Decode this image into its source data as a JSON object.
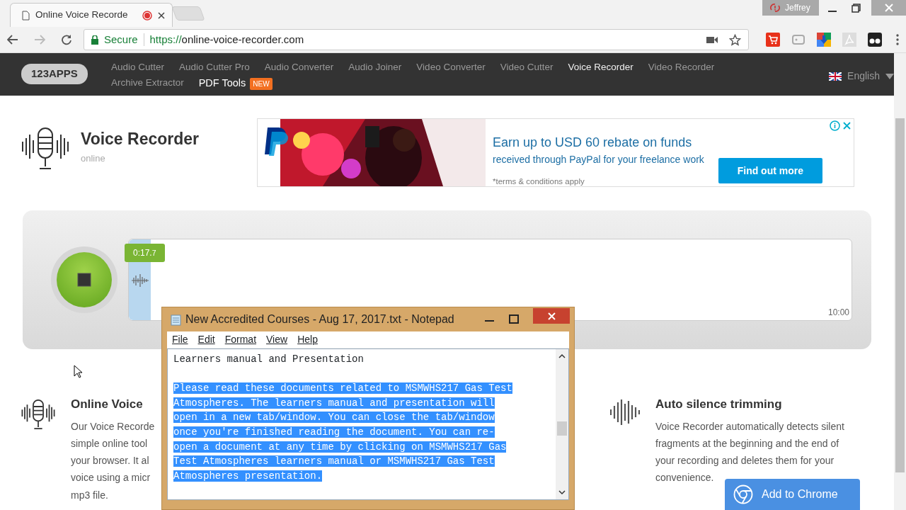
{
  "browser": {
    "tab": {
      "title": "Online Voice Recorde",
      "recording": true
    },
    "user": "Jeffrey",
    "address": {
      "security": "Secure",
      "url_scheme": "https://",
      "url_host": "online-voice-recorder.com"
    }
  },
  "site_nav": {
    "logo": "123APPS",
    "items": [
      {
        "label": "Audio Cutter",
        "selected": false
      },
      {
        "label": "Audio Cutter Pro",
        "selected": false
      },
      {
        "label": "Audio Converter",
        "selected": false
      },
      {
        "label": "Audio Joiner",
        "selected": false
      },
      {
        "label": "Video Converter",
        "selected": false
      },
      {
        "label": "Video Cutter",
        "selected": false
      },
      {
        "label": "Voice Recorder",
        "selected": true
      },
      {
        "label": "Video Recorder",
        "selected": false
      },
      {
        "label": "Archive Extractor",
        "selected": false
      }
    ],
    "featured_link": {
      "label": "PDF Tools",
      "badge": "NEW"
    },
    "language": "English"
  },
  "app_header": {
    "title": "Voice Recorder",
    "subtitle": "online"
  },
  "ad": {
    "headline": "Earn up to USD 60 rebate on funds",
    "subline": "received through PayPal for your freelance work",
    "note": "*terms & conditions apply",
    "button": "Find out more"
  },
  "recorder": {
    "timer": "0:17.",
    "timer_small": "7",
    "limit": "10:00",
    "level": 0.03,
    "recording": true
  },
  "features": [
    {
      "title": "Online Voice",
      "lines": [
        "Our Voice Recorde",
        "simple online tool",
        "your browser. It al",
        "voice using a micr",
        "mp3 file."
      ]
    },
    {
      "title": "Auto silence trimming",
      "lines": [
        "Voice Recorder automatically detects silent",
        "fragments at the beginning and the end of",
        "your recording and deletes them for your",
        "convenience."
      ]
    }
  ],
  "notepad": {
    "title": "New Accredited Courses - Aug 17, 2017.txt - Notepad",
    "menu": [
      "File",
      "Edit",
      "Format",
      "View",
      "Help"
    ],
    "heading": "Learners manual and Presentation",
    "selected_lines": [
      "Please read these documents related to MSMWHS217 Gas Test",
      "Atmospheres. The learners manual and presentation will",
      "open in a new tab/window. You can close the tab/window",
      "once you're finished reading the document. You can re-",
      "open a document at any time by clicking on MSMWHS217 Gas",
      "Test Atmospheres learners manual or MSMWHS217 Gas Test",
      "Atmospheres presentation."
    ]
  },
  "extension_popup": {
    "button": "Add to Chrome"
  }
}
